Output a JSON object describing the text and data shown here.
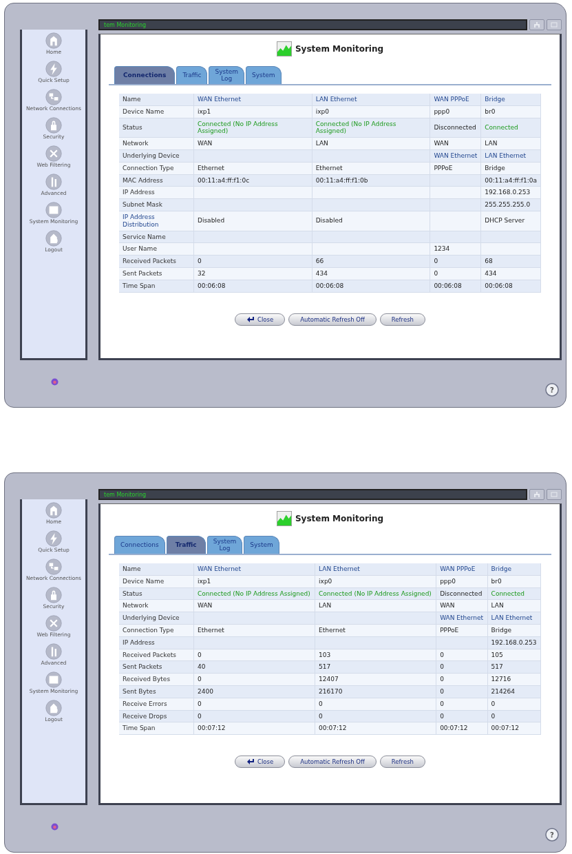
{
  "panels": [
    {
      "title_bar": "tem Monitoring",
      "heading": "System Monitoring",
      "sidebar": [
        {
          "label": "Home"
        },
        {
          "label": "Quick Setup"
        },
        {
          "label": "Network Connections"
        },
        {
          "label": "Security"
        },
        {
          "label": "Web Filtering"
        },
        {
          "label": "Advanced"
        },
        {
          "label": "System Monitoring"
        },
        {
          "label": "Logout"
        }
      ],
      "tabs": [
        {
          "label": "Connections",
          "selected": true
        },
        {
          "label": "Traffic",
          "selected": false
        },
        {
          "label": "System Log",
          "selected": false
        },
        {
          "label": "System",
          "selected": false
        }
      ],
      "table": {
        "rows": [
          {
            "label": "Name",
            "cells": [
              {
                "text": "WAN Ethernet",
                "kind": "link"
              },
              {
                "text": "LAN Ethernet",
                "kind": "link"
              },
              {
                "text": "WAN PPPoE",
                "kind": "link"
              },
              {
                "text": "Bridge",
                "kind": "link"
              }
            ]
          },
          {
            "label": "Device Name",
            "cells": [
              "ixp1",
              "ixp0",
              "ppp0",
              "br0"
            ]
          },
          {
            "label": "Status",
            "cells": [
              {
                "text": "Connected (No IP Address Assigned)",
                "kind": "ok"
              },
              {
                "text": "Connected (No IP Address Assigned)",
                "kind": "ok"
              },
              "Disconnected",
              {
                "text": "Connected",
                "kind": "ok"
              }
            ]
          },
          {
            "label": "Network",
            "cells": [
              "WAN",
              "LAN",
              "WAN",
              "LAN"
            ]
          },
          {
            "label": "Underlying Device",
            "cells": [
              null,
              null,
              {
                "text": "WAN Ethernet",
                "kind": "link"
              },
              {
                "text": "LAN Ethernet",
                "kind": "link"
              }
            ]
          },
          {
            "label": "Connection Type",
            "cells": [
              "Ethernet",
              "Ethernet",
              "PPPoE",
              "Bridge"
            ]
          },
          {
            "label": "MAC Address",
            "cells": [
              "00:11:a4:ff:f1:0c",
              "00:11:a4:ff:f1:0b",
              null,
              "00:11:a4:ff:f1:0a"
            ]
          },
          {
            "label": "IP Address",
            "cells": [
              null,
              null,
              null,
              "192.168.0.253"
            ]
          },
          {
            "label": "Subnet Mask",
            "cells": [
              null,
              null,
              null,
              "255.255.255.0"
            ]
          },
          {
            "label": {
              "text": "IP Address Distribution",
              "kind": "link"
            },
            "cells": [
              "Disabled",
              "Disabled",
              null,
              "DHCP Server"
            ]
          },
          {
            "label": "Service Name",
            "cells": [
              null,
              null,
              null,
              null
            ]
          },
          {
            "label": "User Name",
            "cells": [
              null,
              null,
              "1234",
              null
            ]
          },
          {
            "label": "Received Packets",
            "cells": [
              "0",
              "66",
              "0",
              "68"
            ]
          },
          {
            "label": "Sent Packets",
            "cells": [
              "32",
              "434",
              "0",
              "434"
            ]
          },
          {
            "label": "Time Span",
            "cells": [
              "00:06:08",
              "00:06:08",
              "00:06:08",
              "00:06:08"
            ]
          }
        ]
      },
      "buttons": [
        {
          "label": "Close",
          "kind": "close"
        },
        {
          "label": "Automatic Refresh Off",
          "kind": "plain"
        },
        {
          "label": "Refresh",
          "kind": "plain"
        }
      ],
      "help": "?"
    },
    {
      "title_bar": "tem Monitoring",
      "heading": "System Monitoring",
      "sidebar": [
        {
          "label": "Home"
        },
        {
          "label": "Quick Setup"
        },
        {
          "label": "Network Connections"
        },
        {
          "label": "Security"
        },
        {
          "label": "Web Filtering"
        },
        {
          "label": "Advanced"
        },
        {
          "label": "System Monitoring"
        },
        {
          "label": "Logout"
        }
      ],
      "tabs": [
        {
          "label": "Connections",
          "selected": false
        },
        {
          "label": "Traffic",
          "selected": true
        },
        {
          "label": "System Log",
          "selected": false
        },
        {
          "label": "System",
          "selected": false
        }
      ],
      "table": {
        "rows": [
          {
            "label": "Name",
            "cells": [
              {
                "text": "WAN Ethernet",
                "kind": "link"
              },
              {
                "text": "LAN Ethernet",
                "kind": "link"
              },
              {
                "text": "WAN PPPoE",
                "kind": "link"
              },
              {
                "text": "Bridge",
                "kind": "link"
              }
            ]
          },
          {
            "label": "Device Name",
            "cells": [
              "ixp1",
              "ixp0",
              "ppp0",
              "br0"
            ]
          },
          {
            "label": "Status",
            "cells": [
              {
                "text": "Connected (No IP Address Assigned)",
                "kind": "ok"
              },
              {
                "text": "Connected (No IP Address Assigned)",
                "kind": "ok"
              },
              "Disconnected",
              {
                "text": "Connected",
                "kind": "ok"
              }
            ]
          },
          {
            "label": "Network",
            "cells": [
              "WAN",
              "LAN",
              "WAN",
              "LAN"
            ]
          },
          {
            "label": "Underlying Device",
            "cells": [
              null,
              null,
              {
                "text": "WAN Ethernet",
                "kind": "link"
              },
              {
                "text": "LAN Ethernet",
                "kind": "link"
              }
            ]
          },
          {
            "label": "Connection Type",
            "cells": [
              "Ethernet",
              "Ethernet",
              "PPPoE",
              "Bridge"
            ]
          },
          {
            "label": "IP Address",
            "cells": [
              null,
              null,
              null,
              "192.168.0.253"
            ]
          },
          {
            "label": "Received Packets",
            "cells": [
              "0",
              "103",
              "0",
              "105"
            ]
          },
          {
            "label": "Sent Packets",
            "cells": [
              "40",
              "517",
              "0",
              "517"
            ]
          },
          {
            "label": "Received Bytes",
            "cells": [
              "0",
              "12407",
              "0",
              "12716"
            ]
          },
          {
            "label": "Sent Bytes",
            "cells": [
              "2400",
              "216170",
              "0",
              "214264"
            ]
          },
          {
            "label": "Receive Errors",
            "cells": [
              "0",
              "0",
              "0",
              "0"
            ]
          },
          {
            "label": "Receive Drops",
            "cells": [
              "0",
              "0",
              "0",
              "0"
            ]
          },
          {
            "label": "Time Span",
            "cells": [
              "00:07:12",
              "00:07:12",
              "00:07:12",
              "00:07:12"
            ]
          }
        ]
      },
      "buttons": [
        {
          "label": "Close",
          "kind": "close"
        },
        {
          "label": "Automatic Refresh Off",
          "kind": "plain"
        },
        {
          "label": "Refresh",
          "kind": "plain"
        }
      ],
      "help": "?"
    }
  ]
}
